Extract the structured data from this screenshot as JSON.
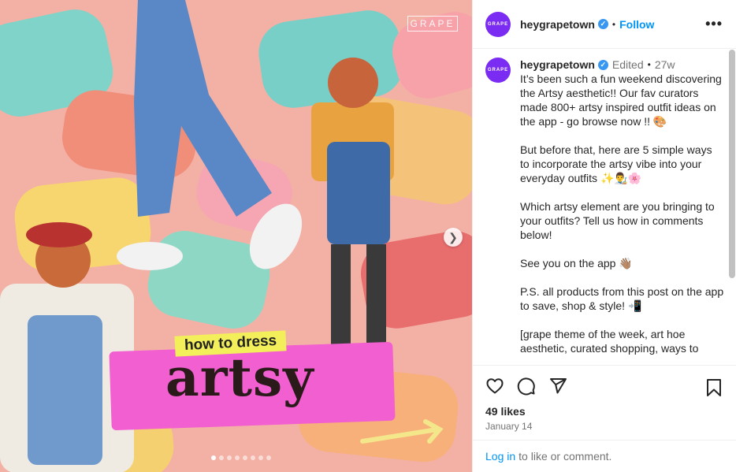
{
  "media": {
    "watermark": "GRAPE",
    "banner_small": "how to dress",
    "banner_big": "artsy",
    "slide_count": 8,
    "active_slide": 1
  },
  "header": {
    "avatar_text": "GRAPE",
    "username": "heygrapetown",
    "verified": true,
    "separator": "•",
    "follow_label": "Follow",
    "more_label": "•••"
  },
  "caption": {
    "username": "heygrapetown",
    "edited": "Edited",
    "separator": "•",
    "age": "27w",
    "text": "It’s been such a fun weekend discovering the Artsy aesthetic!! Our fav curators made 800+ artsy inspired outfit ideas on the app - go browse now !! 🎨\n\nBut before that, here are 5 simple ways to incorporate the artsy vibe into your everyday outfits ✨👨‍🎨🌸\n\nWhich artsy element are you bringing to your outfits? Tell us how in comments below!\n\nSee you on the app 👋🏽\n\nP.S. all products from this post on the app to save, shop & style! 📲\n\n[grape theme of the week, art hoe aesthetic, curated shopping, ways to"
  },
  "actions": {
    "likes": "49 likes",
    "date": "January 14"
  },
  "login": {
    "link": "Log in",
    "rest": "to like or comment."
  },
  "colors": {
    "brand_purple": "#7b2cf2",
    "link_blue": "#0095f6",
    "verified_blue": "#3897f0",
    "banner_pink": "#f25fd0",
    "banner_yellow": "#f3ef5a"
  }
}
